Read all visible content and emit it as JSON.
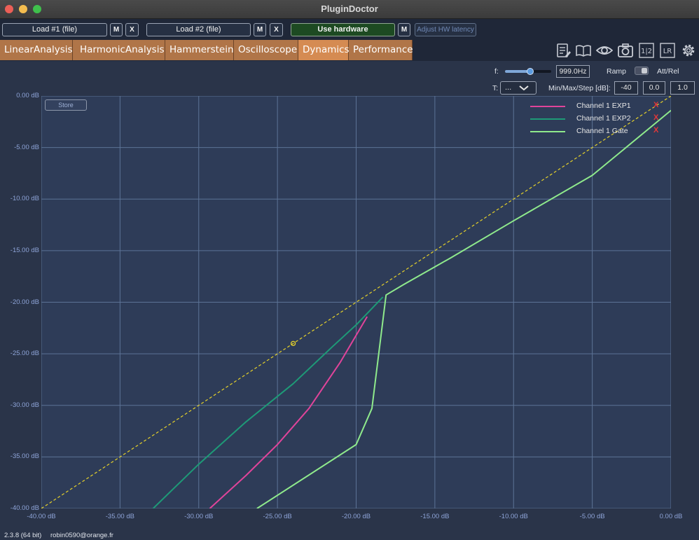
{
  "window": {
    "title": "PluginDoctor"
  },
  "toolbar": {
    "load1": "Load #1 (file)",
    "load1_m": "M",
    "load1_x": "X",
    "load2": "Load #2 (file)",
    "load2_m": "M",
    "load2_x": "X",
    "use_hardware": "Use hardware",
    "hardware_m": "M",
    "adjust_latency": "Adjust HW latency"
  },
  "tabs": [
    {
      "label": "LinearAnalysis"
    },
    {
      "label": "HarmonicAnalysis"
    },
    {
      "label": "Hammerstein"
    },
    {
      "label": "Oscilloscope"
    },
    {
      "label": "Dynamics",
      "active": true
    },
    {
      "label": "Performance"
    }
  ],
  "tool_icons": [
    "notes-icon",
    "manual-book-icon",
    "eye-icon",
    "camera-icon",
    "half-icon",
    "lr-icon",
    "gear-icon"
  ],
  "tool_icon_text": {
    "half": "1|2",
    "lr": "LR"
  },
  "controls": {
    "f_label": "f:",
    "frequency": "999.0Hz",
    "slider_level": 0.55,
    "ramp_label": "Ramp",
    "att_rel_label": "Att/Rel",
    "t_label": "T:",
    "t_value": "...",
    "minmaxstep_label": "Min/Max/Step [dB]:",
    "min": "-40",
    "max": "0.0",
    "step": "1.0"
  },
  "plot": {
    "store_label": "Store",
    "legend": [
      {
        "label": "Channel 1 EXP1",
        "color": "#e0449a",
        "remove": "X"
      },
      {
        "label": "Channel 1 EXP2",
        "color": "#1e9a77",
        "remove": "X"
      },
      {
        "label": "Channel 1 Gate",
        "color": "#8fea8c",
        "remove": "X"
      }
    ]
  },
  "chart_data": {
    "type": "line",
    "title": "",
    "xlabel": "",
    "ylabel": "",
    "xlim": [
      -40,
      0
    ],
    "ylim": [
      -40,
      0
    ],
    "x_tick_labels": [
      "-40.00 dB",
      "-35.00 dB",
      "-30.00 dB",
      "-25.00 dB",
      "-20.00 dB",
      "-15.00 dB",
      "-10.00 dB",
      "-5.00 dB",
      "0.00 dB"
    ],
    "y_tick_labels": [
      "0.00 dB",
      "-5.00 dB",
      "-10.00 dB",
      "-15.00 dB",
      "-20.00 dB",
      "-25.00 dB",
      "-30.00 dB",
      "-35.00 dB",
      "-40.00 dB"
    ],
    "grid": true,
    "legend_position": "top-right",
    "reference_line": {
      "x": [
        -40,
        0
      ],
      "y": [
        -40,
        0
      ],
      "color": "#e6d22a",
      "style": "dashed"
    },
    "marker_point": {
      "x": -24,
      "y": -24,
      "color": "#e6d22a"
    },
    "series": [
      {
        "name": "Channel 1 EXP1",
        "color": "#e0449a",
        "x": [
          -29.3,
          -27,
          -25,
          -23,
          -21,
          -19.3
        ],
        "y": [
          -40,
          -36.8,
          -33.8,
          -30.3,
          -25.8,
          -21.4
        ]
      },
      {
        "name": "Channel 1 EXP2",
        "color": "#1e9a77",
        "x": [
          -32.9,
          -30,
          -27,
          -24,
          -21.5,
          -20,
          -18.3
        ],
        "y": [
          -40,
          -35.7,
          -31.6,
          -27.9,
          -24.3,
          -22.2,
          -19.5
        ]
      },
      {
        "name": "Channel 1 Gate",
        "color": "#8fea8c",
        "x": [
          -26.3,
          -20,
          -19.0,
          -18.1,
          -17,
          -14,
          -10,
          -5,
          0
        ],
        "y": [
          -40,
          -33.8,
          -30.3,
          -19.3,
          -18.3,
          -15.7,
          -12.1,
          -7.7,
          -1.4
        ]
      }
    ]
  },
  "status": {
    "version": "2.3.8 (64 bit)",
    "user": "robin0590@orange.fr"
  }
}
